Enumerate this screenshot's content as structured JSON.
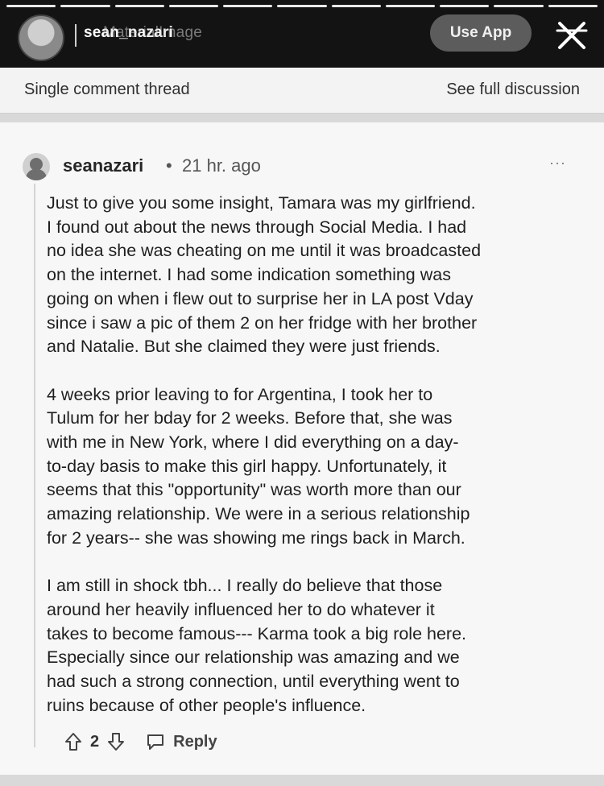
{
  "story": {
    "progress_total": 11,
    "progress_done": 11,
    "title_name": "sean_nazari",
    "title_overlap": "MaterialImage",
    "use_app_label": "Use App",
    "close_icon": "close-icon"
  },
  "subheader": {
    "left_label": "Single comment thread",
    "right_label": "See full discussion"
  },
  "comment": {
    "author": "seanazari",
    "separator": "•",
    "time": "21 hr. ago",
    "more": "···",
    "paragraphs": [
      "Just to give you some insight, Tamara was my girlfriend.\nI found out about the news through Social Media. I had\nno idea she was cheating on me until it was broadcasted\non the internet. I had some indication something was\ngoing on when i flew out to surprise her in LA post Vday\nsince i saw a pic of them 2 on her fridge with her brother\nand Natalie. But she claimed they were just friends.",
      "4 weeks prior leaving to for Argentina, I took her to\nTulum for her bday for 2 weeks. Before that, she was\nwith me in New York, where I did everything on a day-\nto-day basis to make this girl happy. Unfortunately, it\nseems that this \"opportunity\" was worth more than our\namazing relationship. We were in a serious relationship\nfor 2 years-- she was showing me rings back in March.",
      "I am still in shock tbh... I really do believe that those\naround her heavily influenced her to do whatever it\ntakes to become famous--- Karma took a big role here.\nEspecially since our relationship was amazing and we\nhad such a strong connection, until everything went to\nruins because of other people's influence."
    ],
    "vote_count": "2",
    "reply_label": "Reply"
  }
}
